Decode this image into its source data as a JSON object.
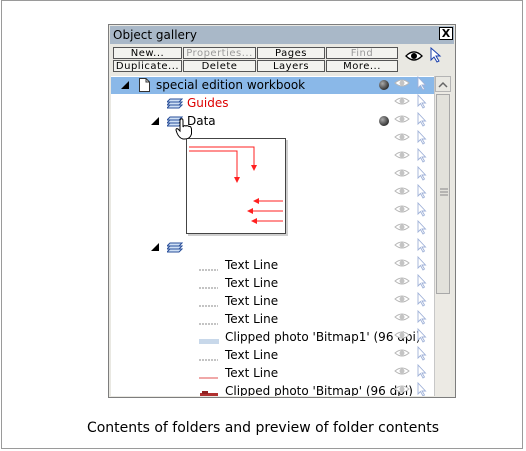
{
  "panel": {
    "title": "Object gallery",
    "close_label": "X",
    "buttons_row1": [
      "New...",
      "Properties...",
      "Pages",
      "Find"
    ],
    "buttons_row2": [
      "Duplicate...",
      "Delete",
      "Layers",
      "More..."
    ],
    "disabled": [
      "Properties...",
      "Find"
    ]
  },
  "tree": {
    "workbook": "special edition workbook",
    "guides": "Guides",
    "data": "Data",
    "items": [
      "Text Line",
      "Text Line",
      "Text Line",
      "Text Line",
      "Clipped photo 'Bitmap1' (96 dpi)",
      "Text Line",
      "Text Line",
      "Clipped photo 'Bitmap' (96 dpi)"
    ]
  },
  "caption": "Contents of folders and preview of folder contents",
  "colors": {
    "selection": "#8ab8e8",
    "guides_text": "#dd0000",
    "preview_lines": "#ff2020"
  }
}
